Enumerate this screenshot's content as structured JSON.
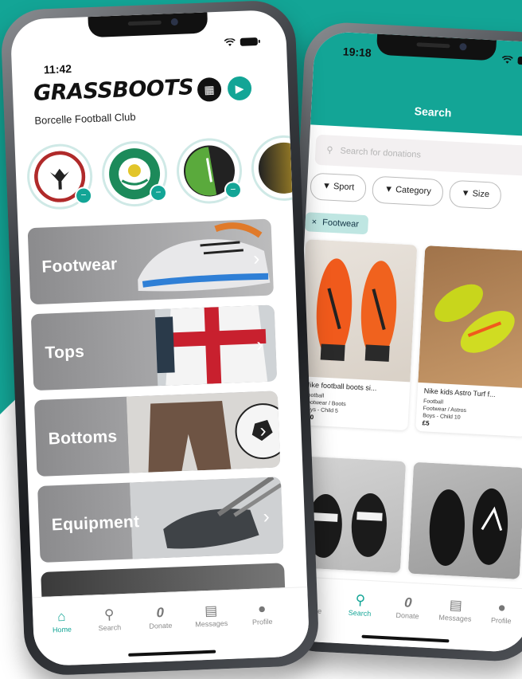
{
  "colors": {
    "teal": "#13a596",
    "teal_light": "#bfe6e2"
  },
  "front": {
    "status": {
      "time": "11:42"
    },
    "brand": "GRASSBOOTS",
    "club_name": "Borcelle Football Club",
    "club_badges": [
      {
        "name": "borcelle-badge",
        "text": "BORCELLE FOOTBALL CLUB",
        "color": "#b02a2a"
      },
      {
        "name": "field-hockey-badge",
        "text": "FIELD HOCKEY",
        "color": "#1c8a5a"
      },
      {
        "name": "golf-badge",
        "text": "",
        "color": "#5aaa3c"
      },
      {
        "name": "partial-badge",
        "text": "",
        "color": "#222"
      }
    ],
    "categories": [
      {
        "label": "Footwear"
      },
      {
        "label": "Tops"
      },
      {
        "label": "Bottoms"
      },
      {
        "label": "Equipment"
      }
    ],
    "tabs": [
      {
        "label": "Home",
        "icon": "home-icon",
        "active": true
      },
      {
        "label": "Search",
        "icon": "search-icon",
        "active": false
      },
      {
        "label": "Donate",
        "icon": "donate-icon",
        "active": false
      },
      {
        "label": "Messages",
        "icon": "messages-icon",
        "active": false
      },
      {
        "label": "Profile",
        "icon": "profile-icon",
        "active": false
      }
    ]
  },
  "back": {
    "status": {
      "time": "19:18"
    },
    "title": "Search",
    "search_placeholder": "Search for donations",
    "filters": [
      "Sport",
      "Category",
      "Size"
    ],
    "active_chip": "Footwear",
    "listings": [
      {
        "title": "Nike football boots si...",
        "sport": "Football",
        "category": "Footwear / Boots",
        "size": "Boys - Child 5",
        "price": "£10"
      },
      {
        "title": "Nike kids Astro Turf f...",
        "sport": "Football",
        "category": "Footwear / Astros",
        "size": "Boys - Child 10",
        "price": "£5"
      }
    ],
    "tabs": [
      {
        "label": "Home",
        "icon": "home-icon",
        "active": false
      },
      {
        "label": "Search",
        "icon": "search-icon",
        "active": true
      },
      {
        "label": "Donate",
        "icon": "donate-icon",
        "active": false
      },
      {
        "label": "Messages",
        "icon": "messages-icon",
        "active": false
      },
      {
        "label": "Profile",
        "icon": "profile-icon",
        "active": false
      }
    ]
  }
}
